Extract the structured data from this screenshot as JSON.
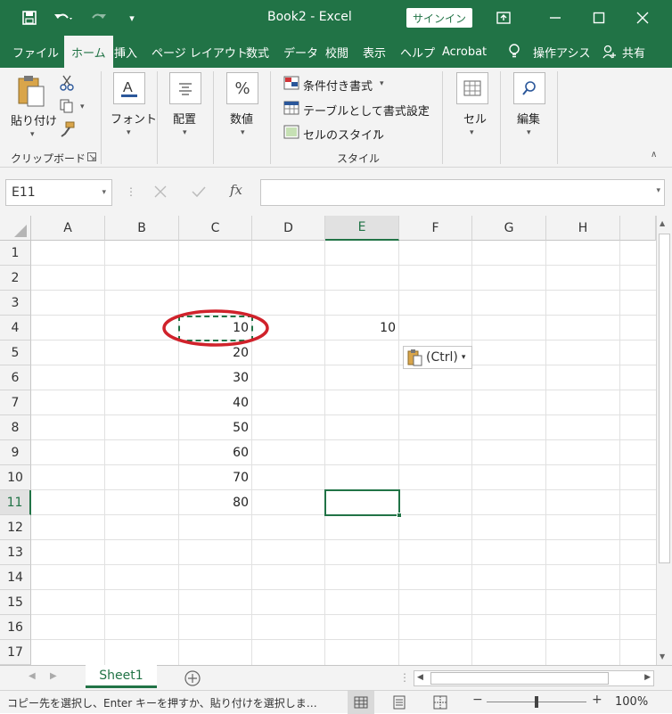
{
  "window": {
    "title": "Book2  -  Excel",
    "signin_label": "サインイン"
  },
  "tabs": [
    "ファイル",
    "ホーム",
    "挿入",
    "ページ レイアウト",
    "数式",
    "データ",
    "校閲",
    "表示",
    "ヘルプ",
    "Acrobat",
    "操作アシス",
    "共有"
  ],
  "active_tab": "ホーム",
  "ribbon": {
    "paste_label": "貼り付け",
    "clipboard_group": "クリップボード",
    "font_label": "フォント",
    "alignment_label": "配置",
    "number_label": "数値",
    "conditional_format": "条件付き書式",
    "format_as_table": "テーブルとして書式設定",
    "cell_styles": "セルのスタイル",
    "styles_group": "スタイル",
    "cells_label": "セル",
    "editing_label": "編集"
  },
  "formula_bar": {
    "name_box": "E11",
    "formula": ""
  },
  "columns": [
    "A",
    "B",
    "C",
    "D",
    "E",
    "F",
    "G",
    "H"
  ],
  "rows": [
    "1",
    "2",
    "3",
    "4",
    "5",
    "6",
    "7",
    "8",
    "9",
    "10",
    "11",
    "12",
    "13",
    "14",
    "15",
    "16",
    "17"
  ],
  "selected_cell": "E11",
  "cells": {
    "C4": "10",
    "C5": "20",
    "C6": "30",
    "C7": "40",
    "C8": "50",
    "C9": "60",
    "C10": "70",
    "C11": "80",
    "E4": "10"
  },
  "paste_options_label": "(Ctrl)",
  "sheet_tabs": [
    "Sheet1"
  ],
  "status": {
    "message": "コピー先を選択し、Enter キーを押すか、貼り付けを選択しま…",
    "zoom": "100%"
  },
  "colors": {
    "excel_green": "#217346",
    "annotation_red": "#d0222b"
  }
}
